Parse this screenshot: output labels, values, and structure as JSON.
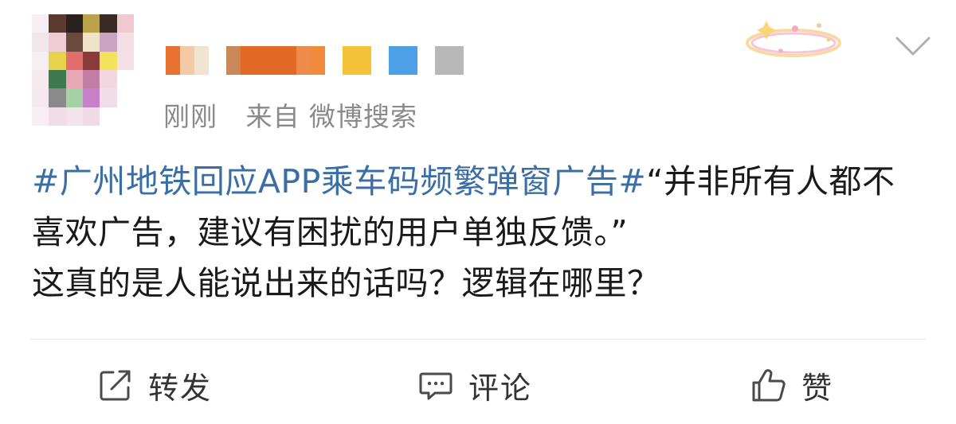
{
  "post": {
    "time": "刚刚",
    "source": "来自 微博搜索",
    "topic": "#广州地铁回应APP乘车码频繁弹窗广告#",
    "body": "“并非所有人都不喜欢广告，建议有困扰的用户单独反馈。”",
    "comment": "这真的是人能说出来的话吗？逻辑在哪里？"
  },
  "actions": {
    "repost_label": "转发",
    "comment_label": "评论",
    "like_label": "赞"
  },
  "icons": {
    "more": "chevron-down-icon",
    "repost": "share-square-arrow-icon",
    "comment": "speech-bubble-icon",
    "like": "thumbs-up-icon"
  },
  "colors": {
    "topic_link": "#3b6ea5",
    "text": "#1a1a1a",
    "meta": "#8a8a8a",
    "icon": "#4a4a4a"
  }
}
